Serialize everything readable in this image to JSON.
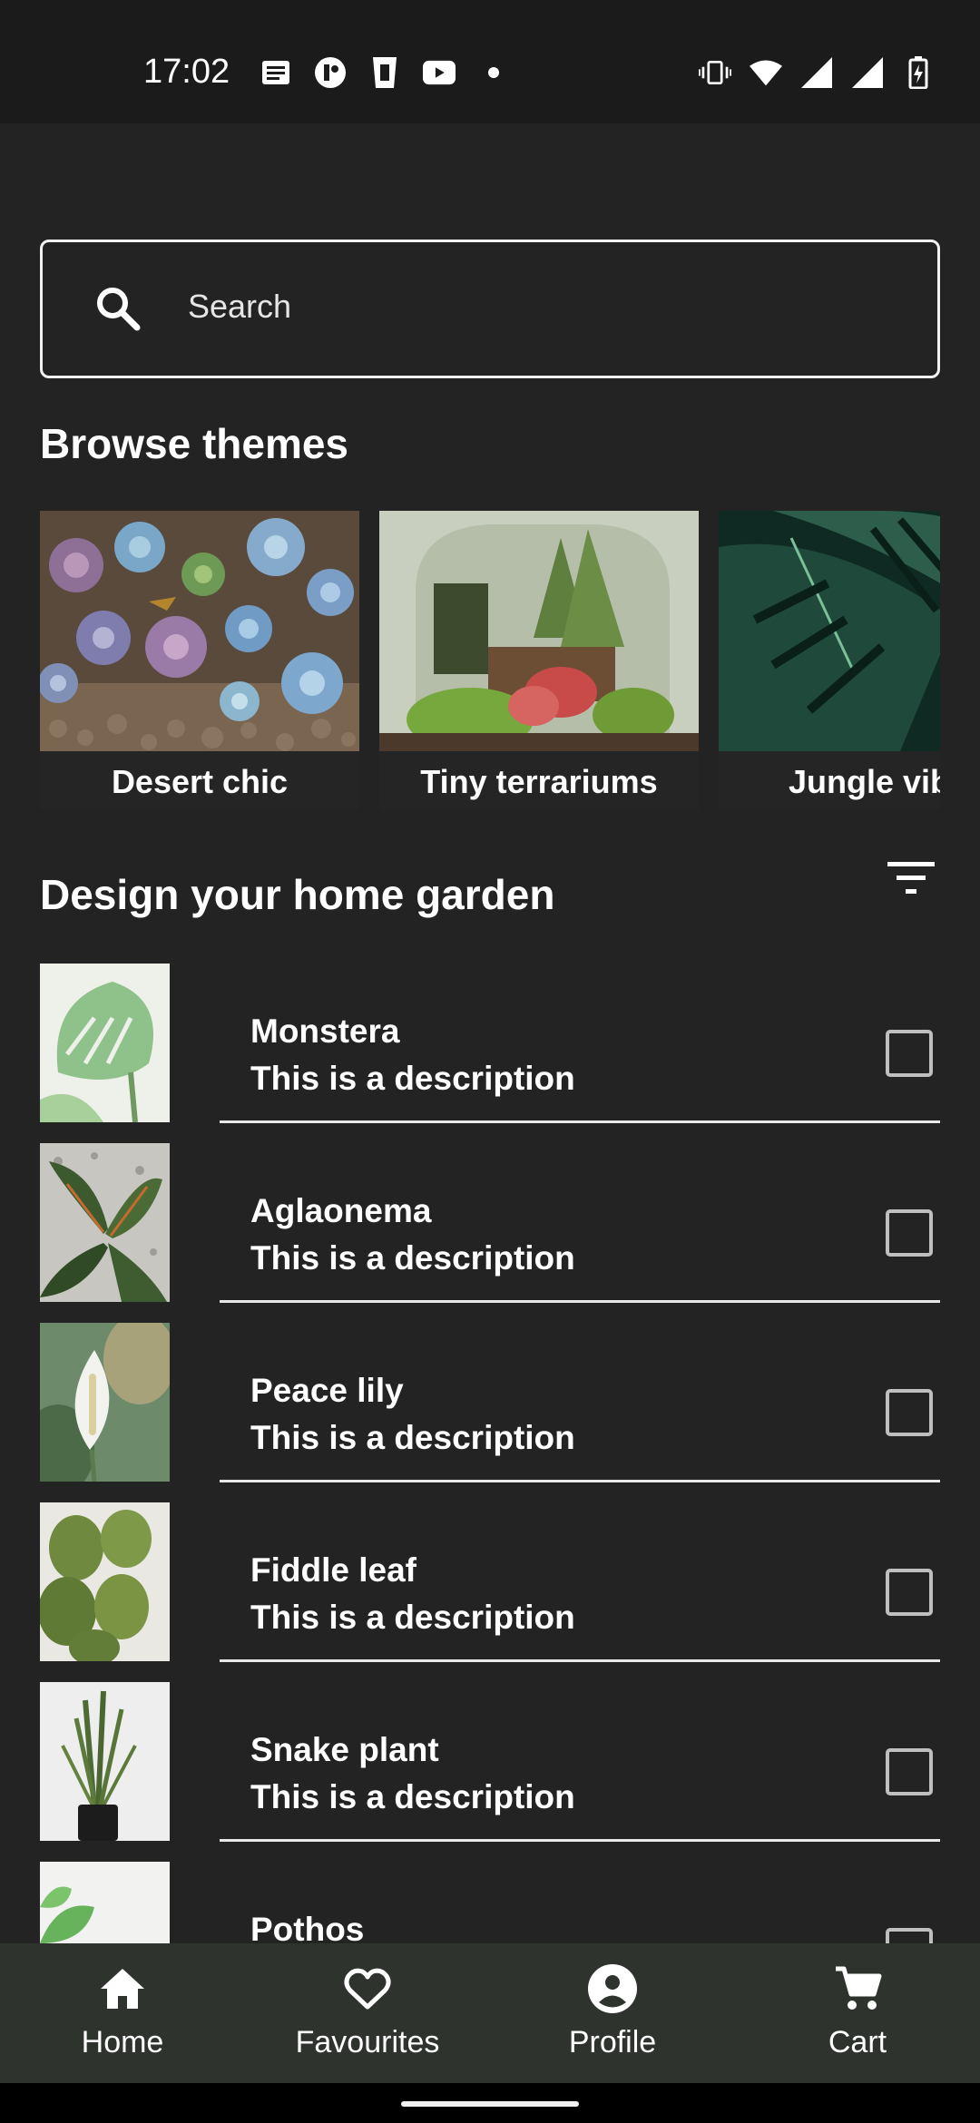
{
  "status_bar": {
    "time": "17:02",
    "left_icons": [
      "news-icon",
      "app-icon",
      "cup-icon",
      "youtube-icon",
      "dot-icon"
    ],
    "right_icons": [
      "vibrate-icon",
      "wifi-icon",
      "signal-icon",
      "signal-icon",
      "battery-charging-icon"
    ]
  },
  "search": {
    "placeholder": "Search",
    "icon": "search-icon"
  },
  "browse_themes": {
    "title": "Browse themes",
    "items": [
      {
        "label": "Desert chic"
      },
      {
        "label": "Tiny terrariums"
      },
      {
        "label": "Jungle vibe"
      }
    ]
  },
  "garden": {
    "title": "Design your home garden",
    "filter_icon": "filter-icon",
    "plants": [
      {
        "name": "Monstera",
        "description": "This is a description",
        "checked": false
      },
      {
        "name": "Aglaonema",
        "description": "This is a description",
        "checked": false
      },
      {
        "name": "Peace lily",
        "description": "This is a description",
        "checked": false
      },
      {
        "name": "Fiddle leaf",
        "description": "This is a description",
        "checked": false
      },
      {
        "name": "Snake plant",
        "description": "This is a description",
        "checked": false
      },
      {
        "name": "Pothos",
        "description": "",
        "checked": false
      }
    ]
  },
  "bottom_nav": {
    "items": [
      {
        "label": "Home",
        "icon": "home-icon"
      },
      {
        "label": "Favourites",
        "icon": "heart-icon"
      },
      {
        "label": "Profile",
        "icon": "profile-icon"
      },
      {
        "label": "Cart",
        "icon": "cart-icon"
      }
    ]
  },
  "colors": {
    "background": "#232323",
    "status_bar": "#1b1b1b",
    "bottom_nav": "#2e332e",
    "text": "#ffffff"
  }
}
